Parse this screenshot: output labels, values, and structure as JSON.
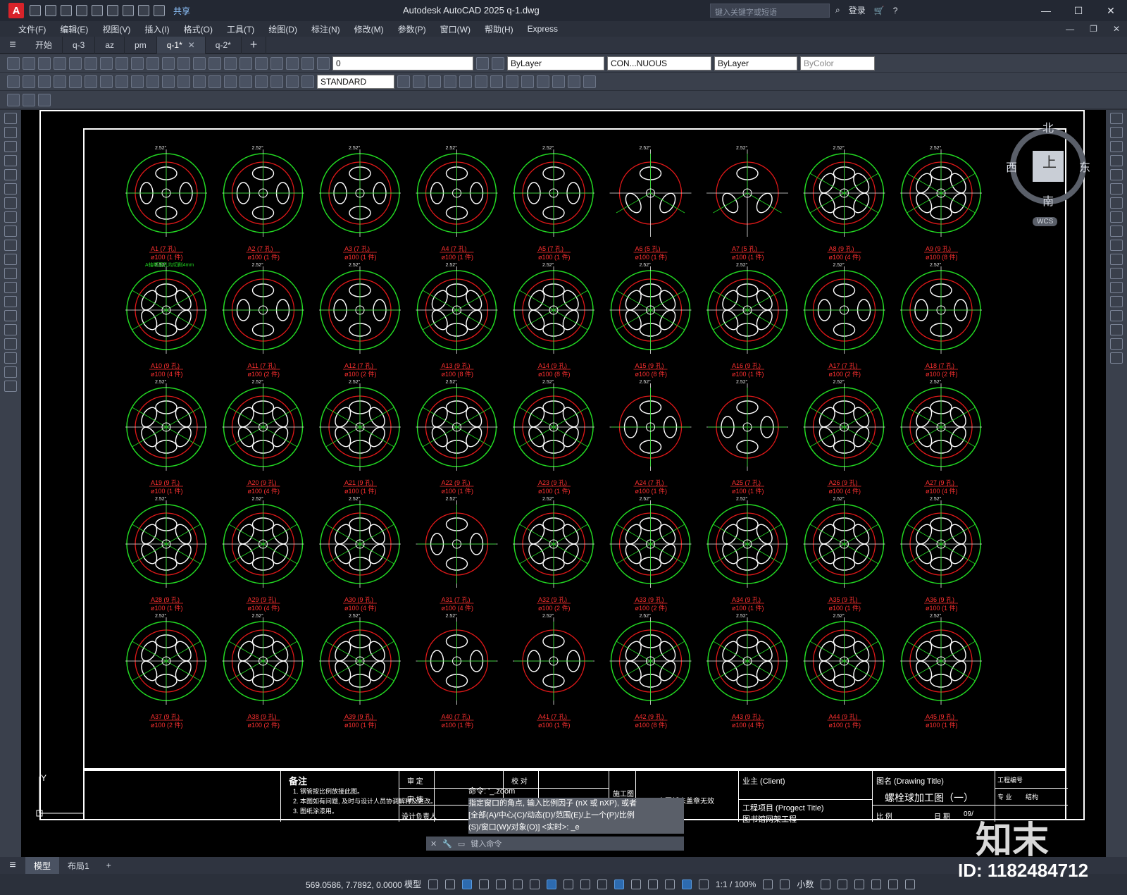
{
  "title_bar": {
    "app_logo": "A",
    "share": "共享",
    "window_title": "Autodesk AutoCAD 2025    q-1.dwg",
    "search_placeholder": "键入关键字或短语",
    "login": "登录"
  },
  "menu": [
    "文件(F)",
    "编辑(E)",
    "视图(V)",
    "插入(I)",
    "格式(O)",
    "工具(T)",
    "绘图(D)",
    "标注(N)",
    "修改(M)",
    "参数(P)",
    "窗口(W)",
    "帮助(H)",
    "Express"
  ],
  "doc_tabs": [
    {
      "label": "开始",
      "active": false
    },
    {
      "label": "q-3",
      "active": false
    },
    {
      "label": "az",
      "active": false
    },
    {
      "label": "pm",
      "active": false
    },
    {
      "label": "q-1*",
      "active": true
    },
    {
      "label": "q-2*",
      "active": false
    }
  ],
  "toolbar": {
    "layer": "0",
    "linetype_color": "ByLayer",
    "linetype": "CON...NUOUS",
    "lineweight": "ByLayer",
    "plotstyle": "ByColor",
    "textstyle": "STANDARD"
  },
  "viewcube": {
    "north": "北",
    "west": "西",
    "east": "东",
    "south": "南",
    "top": "上",
    "wcs": "WCS"
  },
  "drawing": {
    "parts": [
      {
        "id": "A1",
        "holes": "7",
        "qty": "1"
      },
      {
        "id": "A2",
        "holes": "7",
        "qty": "1"
      },
      {
        "id": "A3",
        "holes": "7",
        "qty": "1"
      },
      {
        "id": "A4",
        "holes": "7",
        "qty": "1"
      },
      {
        "id": "A5",
        "holes": "7",
        "qty": "1"
      },
      {
        "id": "A6",
        "holes": "5",
        "qty": "1"
      },
      {
        "id": "A7",
        "holes": "5",
        "qty": "1"
      },
      {
        "id": "A8",
        "holes": "9",
        "qty": "4"
      },
      {
        "id": "A9",
        "holes": "9",
        "qty": "8"
      },
      {
        "id": "A10",
        "holes": "9",
        "qty": "4"
      },
      {
        "id": "A11",
        "holes": "7",
        "qty": "2"
      },
      {
        "id": "A12",
        "holes": "7",
        "qty": "2"
      },
      {
        "id": "A13",
        "holes": "9",
        "qty": "8"
      },
      {
        "id": "A14",
        "holes": "9",
        "qty": "8"
      },
      {
        "id": "A15",
        "holes": "9",
        "qty": "8"
      },
      {
        "id": "A16",
        "holes": "9",
        "qty": "1"
      },
      {
        "id": "A17",
        "holes": "7",
        "qty": "2"
      },
      {
        "id": "A18",
        "holes": "7",
        "qty": "2"
      },
      {
        "id": "A19",
        "holes": "9",
        "qty": "1"
      },
      {
        "id": "A20",
        "holes": "9",
        "qty": "4"
      },
      {
        "id": "A21",
        "holes": "9",
        "qty": "1"
      },
      {
        "id": "A22",
        "holes": "9",
        "qty": "1"
      },
      {
        "id": "A23",
        "holes": "9",
        "qty": "1"
      },
      {
        "id": "A24",
        "holes": "7",
        "qty": "1"
      },
      {
        "id": "A25",
        "holes": "7",
        "qty": "1"
      },
      {
        "id": "A26",
        "holes": "9",
        "qty": "4"
      },
      {
        "id": "A27",
        "holes": "9",
        "qty": "4"
      },
      {
        "id": "A28",
        "holes": "9",
        "qty": "1"
      },
      {
        "id": "A29",
        "holes": "9",
        "qty": "4"
      },
      {
        "id": "A30",
        "holes": "9",
        "qty": "4"
      },
      {
        "id": "A31",
        "holes": "7",
        "qty": "4"
      },
      {
        "id": "A32",
        "holes": "9",
        "qty": "2"
      },
      {
        "id": "A33",
        "holes": "9",
        "qty": "2"
      },
      {
        "id": "A34",
        "holes": "9",
        "qty": "1"
      },
      {
        "id": "A35",
        "holes": "9",
        "qty": "1"
      },
      {
        "id": "A36",
        "holes": "9",
        "qty": "1"
      },
      {
        "id": "A37",
        "holes": "9",
        "qty": "2"
      },
      {
        "id": "A38",
        "holes": "9",
        "qty": "2"
      },
      {
        "id": "A39",
        "holes": "9",
        "qty": "1"
      },
      {
        "id": "A40",
        "holes": "7",
        "qty": "1"
      },
      {
        "id": "A41",
        "holes": "7",
        "qty": "1"
      },
      {
        "id": "A42",
        "holes": "9",
        "qty": "8"
      },
      {
        "id": "A43",
        "holes": "9",
        "qty": "4"
      },
      {
        "id": "A44",
        "holes": "9",
        "qty": "1"
      },
      {
        "id": "A45",
        "holes": "9",
        "qty": "1"
      }
    ],
    "note_a1": "A轴断面孔均切削4mm",
    "diameter_prefix": "ø100",
    "angle_label": "2.52°"
  },
  "title_block": {
    "remarks_title": "备注",
    "remarks": [
      "1. 钢管按比例放接此图。",
      "2. 本图如有问题, 及时与设计人员协调解释及更改。",
      "3. 图纸涂漆用。"
    ],
    "review": "审 定",
    "check": "审 核",
    "designer": "设计负责人",
    "proofread": "校 对",
    "construction": "施工图",
    "stamp_note": "本图纸未盖章无效",
    "client": "业主 (Client)",
    "project_title": "工程项目 (Progect Title)",
    "project_name": "图书馆网架工程",
    "drawing_title_label": "图名 (Drawing Title)",
    "drawing_title": "螺栓球加工图（一）",
    "drawing_no_label": "工程编号",
    "specialty": "专 业",
    "structure": "结构",
    "scale": "比 例",
    "date": "日 期",
    "date_value": "09/"
  },
  "command_line": {
    "history": [
      "命令: '_.zoom",
      "指定窗口的角点, 输入比例因子 (nX 或 nXP), 或者",
      "[全部(A)/中心(C)/动态(D)/范围(E)/上一个(P)/比例",
      "(S)/窗口(W)/对象(O)] <实时>: _e"
    ],
    "placeholder": "键入命令"
  },
  "layout_tabs": [
    "模型",
    "布局1"
  ],
  "status_bar": {
    "coords": "569.0586, 7.7892, 0.0000",
    "model": "模型",
    "scale": "1:1 / 100%",
    "units": "小数"
  },
  "watermark": {
    "id": "ID: 1182484712",
    "brand": "知末"
  }
}
